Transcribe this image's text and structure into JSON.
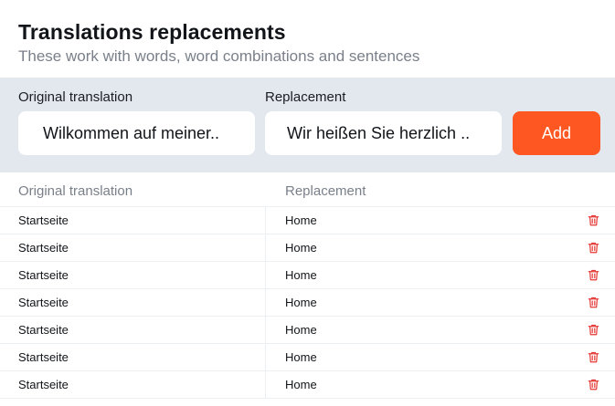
{
  "header": {
    "title": "Translations replacements",
    "subtitle": "These work with words, word combinations and sentences"
  },
  "form": {
    "original_label": "Original translation",
    "original_value": "Wilkommen auf meiner..",
    "replacement_label": "Replacement",
    "replacement_value": "Wir heißen Sie herzlich ..",
    "add_label": "Add"
  },
  "table": {
    "columns": [
      "Original translation",
      "Replacement"
    ],
    "rows": [
      {
        "original": "Startseite",
        "replacement": "Home"
      },
      {
        "original": "Startseite",
        "replacement": "Home"
      },
      {
        "original": "Startseite",
        "replacement": "Home"
      },
      {
        "original": "Startseite",
        "replacement": "Home"
      },
      {
        "original": "Startseite",
        "replacement": "Home"
      },
      {
        "original": "Startseite",
        "replacement": "Home"
      },
      {
        "original": "Startseite",
        "replacement": "Home"
      }
    ],
    "delete_icon": "trash-icon"
  },
  "colors": {
    "accent": "#ff5722",
    "panel": "#e3e8ef",
    "delete": "#e53935",
    "muted_text": "#7a808a"
  }
}
